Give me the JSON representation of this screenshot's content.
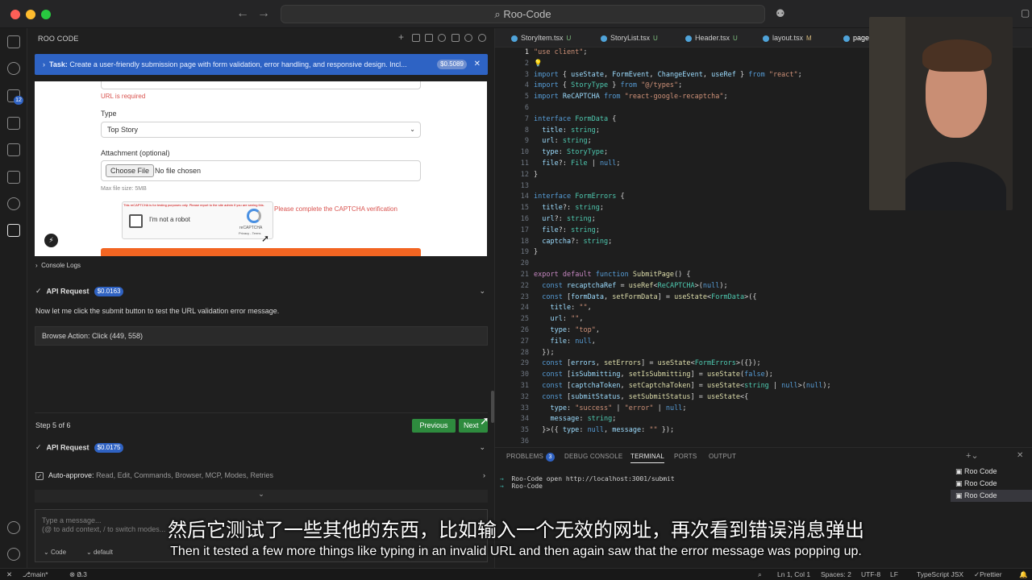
{
  "window": {
    "command_center": "Roo-Code"
  },
  "sidebar": {
    "title": "ROO CODE"
  },
  "task": {
    "label": "Task:",
    "text": "Create a user-friendly submission page with form validation, error handling, and responsive design. Incl...",
    "cost": "$0.5089"
  },
  "browser_page": {
    "url_error": "URL is required",
    "type_label": "Type",
    "type_value": "Top Story",
    "attach_label": "Attachment (optional)",
    "choose_file": "Choose File",
    "no_file": "No file chosen",
    "max_size": "Max file size: 5MB",
    "captcha_notice": "This reCAPTCHA is for testing purposes only. Please report to the site admin if you are seeing this.",
    "captcha_label": "I'm not a robot",
    "captcha_brand": "reCAPTCHA",
    "captcha_links": "Privacy - Terms",
    "captcha_error": "Please complete the CAPTCHA verification"
  },
  "console_logs": "Console Logs",
  "api_request_1": {
    "label": "API Request",
    "cost": "$0.0163"
  },
  "message": "Now let me click the submit button to test the URL validation error message.",
  "browse_action": "Browse Action: Click (449, 558)",
  "stepper": {
    "step": "Step 5 of 6",
    "previous": "Previous",
    "next": "Next"
  },
  "api_request_2": {
    "label": "API Request",
    "cost": "$0.0175"
  },
  "auto_approve": {
    "label": "Auto-approve:",
    "items": "Read, Edit, Commands, Browser, MCP, Modes, Retries"
  },
  "chat": {
    "placeholder_1": "Type a message...",
    "placeholder_2": "(@ to add context, / to switch modes...",
    "mode": "Code",
    "profile": "default"
  },
  "editor_tabs": [
    {
      "name": "StoryItem.tsx",
      "mark": "U"
    },
    {
      "name": "StoryList.tsx",
      "mark": "U"
    },
    {
      "name": "Header.tsx",
      "mark": "U"
    },
    {
      "name": "layout.tsx",
      "mark": "M"
    },
    {
      "name": "page",
      "mark": ""
    }
  ],
  "panel": {
    "tabs": [
      "PROBLEMS",
      "DEBUG CONSOLE",
      "TERMINAL",
      "PORTS",
      "OUTPUT"
    ],
    "problems_count": "3",
    "terminal_line_1": "Roo-Code open http://localhost:3001/submit",
    "terminal_line_2": "Roo-Code",
    "terminals": [
      "Roo Code",
      "Roo Code",
      "Roo Code"
    ]
  },
  "subtitles": {
    "cn": "然后它测试了一些其他的东西，比如输入一个无效的网址，再次看到错误消息弹出",
    "en": "Then it tested a few more things like typing in an invalid URL and then again saw that the error message was popping up."
  },
  "status_bar": {
    "branch": "main*",
    "errors": "0",
    "warnings": "3",
    "position": "Ln 1, Col 1",
    "spaces": "Spaces: 2",
    "encoding": "UTF-8",
    "eol": "LF",
    "language": "TypeScript JSX",
    "formatter": "Prettier"
  }
}
